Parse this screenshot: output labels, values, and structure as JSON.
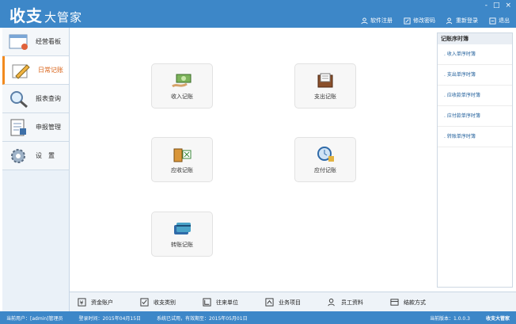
{
  "app": {
    "logo": "收支",
    "logo_sub": "大管家"
  },
  "window_controls": [
    "-",
    "□",
    "×"
  ],
  "top_menu": [
    {
      "label": "软件注册",
      "icon": "user-icon"
    },
    {
      "label": "修改密码",
      "icon": "edit-icon"
    },
    {
      "label": "重新登录",
      "icon": "relogin-icon"
    },
    {
      "label": "退出",
      "icon": "exit-icon"
    }
  ],
  "sidebar": {
    "items": [
      {
        "label": "经营看板",
        "icon": "dashboard-icon"
      },
      {
        "label": "日常记账",
        "icon": "pencil-icon",
        "active": true
      },
      {
        "label": "报表查询",
        "icon": "magnifier-icon"
      },
      {
        "label": "申报管理",
        "icon": "declare-icon"
      },
      {
        "label": "设　置",
        "icon": "gear-icon"
      }
    ]
  },
  "tiles": [
    {
      "label": "收入记账",
      "icon": "income-icon"
    },
    {
      "label": "支出记账",
      "icon": "expense-icon"
    },
    {
      "label": "应收记账",
      "icon": "receivable-icon"
    },
    {
      "label": "应付记账",
      "icon": "payable-icon"
    },
    {
      "label": "转账记账",
      "icon": "transfer-icon"
    }
  ],
  "right_panel": {
    "title": "记账序时簿",
    "items": [
      ". 收入单序时簿",
      ". 支出单序时簿",
      ". 应收款单序时簿",
      ". 应付款单序时簿",
      ". 转账单序时簿"
    ]
  },
  "bottom_bar": [
    {
      "label": "资金账户",
      "icon": "money-icon"
    },
    {
      "label": "收支类别",
      "icon": "check-icon"
    },
    {
      "label": "往来单位",
      "icon": "contact-icon"
    },
    {
      "label": "业务项目",
      "icon": "project-icon"
    },
    {
      "label": "员工资料",
      "icon": "staff-icon"
    },
    {
      "label": "结款方式",
      "icon": "card-icon"
    }
  ],
  "status": {
    "user": "当前用户：[admin]管理员",
    "login_time": "登录时间：2015年04月15日",
    "expiry": "系统已试用，有效期至：2015年05月01日",
    "version": "当前版本：1.0.0.3",
    "brand": "收支大管家"
  },
  "colors": {
    "titlebar": "#3d87c8",
    "active_accent": "#f28a1e"
  }
}
